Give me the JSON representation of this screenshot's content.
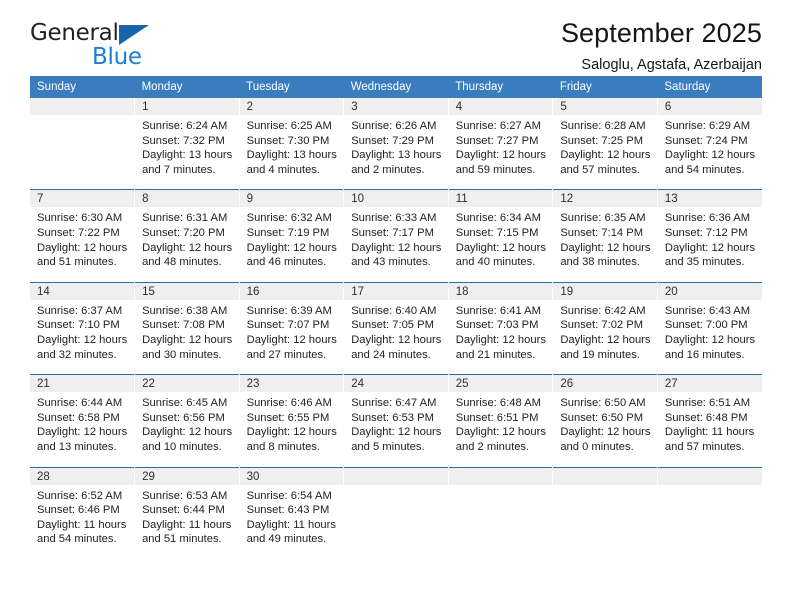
{
  "brand": {
    "line1": "General",
    "line2": "Blue",
    "triangle_color": "#1665ac",
    "line2_color": "#1b7fd4"
  },
  "header": {
    "title": "September 2025",
    "subtitle": "Saloglu, Agstafa, Azerbaijan"
  },
  "theme": {
    "header_blue": "#3a7dbf",
    "row_divider_blue": "#2b6ca8",
    "daynum_band": "#efefef"
  },
  "calendar": {
    "weekday_headers": [
      "Sunday",
      "Monday",
      "Tuesday",
      "Wednesday",
      "Thursday",
      "Friday",
      "Saturday"
    ],
    "weeks": [
      [
        {
          "day": "",
          "lines": []
        },
        {
          "day": "1",
          "lines": [
            "Sunrise: 6:24 AM",
            "Sunset: 7:32 PM",
            "Daylight: 13 hours",
            "and 7 minutes."
          ]
        },
        {
          "day": "2",
          "lines": [
            "Sunrise: 6:25 AM",
            "Sunset: 7:30 PM",
            "Daylight: 13 hours",
            "and 4 minutes."
          ]
        },
        {
          "day": "3",
          "lines": [
            "Sunrise: 6:26 AM",
            "Sunset: 7:29 PM",
            "Daylight: 13 hours",
            "and 2 minutes."
          ]
        },
        {
          "day": "4",
          "lines": [
            "Sunrise: 6:27 AM",
            "Sunset: 7:27 PM",
            "Daylight: 12 hours",
            "and 59 minutes."
          ]
        },
        {
          "day": "5",
          "lines": [
            "Sunrise: 6:28 AM",
            "Sunset: 7:25 PM",
            "Daylight: 12 hours",
            "and 57 minutes."
          ]
        },
        {
          "day": "6",
          "lines": [
            "Sunrise: 6:29 AM",
            "Sunset: 7:24 PM",
            "Daylight: 12 hours",
            "and 54 minutes."
          ]
        }
      ],
      [
        {
          "day": "7",
          "lines": [
            "Sunrise: 6:30 AM",
            "Sunset: 7:22 PM",
            "Daylight: 12 hours",
            "and 51 minutes."
          ]
        },
        {
          "day": "8",
          "lines": [
            "Sunrise: 6:31 AM",
            "Sunset: 7:20 PM",
            "Daylight: 12 hours",
            "and 48 minutes."
          ]
        },
        {
          "day": "9",
          "lines": [
            "Sunrise: 6:32 AM",
            "Sunset: 7:19 PM",
            "Daylight: 12 hours",
            "and 46 minutes."
          ]
        },
        {
          "day": "10",
          "lines": [
            "Sunrise: 6:33 AM",
            "Sunset: 7:17 PM",
            "Daylight: 12 hours",
            "and 43 minutes."
          ]
        },
        {
          "day": "11",
          "lines": [
            "Sunrise: 6:34 AM",
            "Sunset: 7:15 PM",
            "Daylight: 12 hours",
            "and 40 minutes."
          ]
        },
        {
          "day": "12",
          "lines": [
            "Sunrise: 6:35 AM",
            "Sunset: 7:14 PM",
            "Daylight: 12 hours",
            "and 38 minutes."
          ]
        },
        {
          "day": "13",
          "lines": [
            "Sunrise: 6:36 AM",
            "Sunset: 7:12 PM",
            "Daylight: 12 hours",
            "and 35 minutes."
          ]
        }
      ],
      [
        {
          "day": "14",
          "lines": [
            "Sunrise: 6:37 AM",
            "Sunset: 7:10 PM",
            "Daylight: 12 hours",
            "and 32 minutes."
          ]
        },
        {
          "day": "15",
          "lines": [
            "Sunrise: 6:38 AM",
            "Sunset: 7:08 PM",
            "Daylight: 12 hours",
            "and 30 minutes."
          ]
        },
        {
          "day": "16",
          "lines": [
            "Sunrise: 6:39 AM",
            "Sunset: 7:07 PM",
            "Daylight: 12 hours",
            "and 27 minutes."
          ]
        },
        {
          "day": "17",
          "lines": [
            "Sunrise: 6:40 AM",
            "Sunset: 7:05 PM",
            "Daylight: 12 hours",
            "and 24 minutes."
          ]
        },
        {
          "day": "18",
          "lines": [
            "Sunrise: 6:41 AM",
            "Sunset: 7:03 PM",
            "Daylight: 12 hours",
            "and 21 minutes."
          ]
        },
        {
          "day": "19",
          "lines": [
            "Sunrise: 6:42 AM",
            "Sunset: 7:02 PM",
            "Daylight: 12 hours",
            "and 19 minutes."
          ]
        },
        {
          "day": "20",
          "lines": [
            "Sunrise: 6:43 AM",
            "Sunset: 7:00 PM",
            "Daylight: 12 hours",
            "and 16 minutes."
          ]
        }
      ],
      [
        {
          "day": "21",
          "lines": [
            "Sunrise: 6:44 AM",
            "Sunset: 6:58 PM",
            "Daylight: 12 hours",
            "and 13 minutes."
          ]
        },
        {
          "day": "22",
          "lines": [
            "Sunrise: 6:45 AM",
            "Sunset: 6:56 PM",
            "Daylight: 12 hours",
            "and 10 minutes."
          ]
        },
        {
          "day": "23",
          "lines": [
            "Sunrise: 6:46 AM",
            "Sunset: 6:55 PM",
            "Daylight: 12 hours",
            "and 8 minutes."
          ]
        },
        {
          "day": "24",
          "lines": [
            "Sunrise: 6:47 AM",
            "Sunset: 6:53 PM",
            "Daylight: 12 hours",
            "and 5 minutes."
          ]
        },
        {
          "day": "25",
          "lines": [
            "Sunrise: 6:48 AM",
            "Sunset: 6:51 PM",
            "Daylight: 12 hours",
            "and 2 minutes."
          ]
        },
        {
          "day": "26",
          "lines": [
            "Sunrise: 6:50 AM",
            "Sunset: 6:50 PM",
            "Daylight: 12 hours",
            "and 0 minutes."
          ]
        },
        {
          "day": "27",
          "lines": [
            "Sunrise: 6:51 AM",
            "Sunset: 6:48 PM",
            "Daylight: 11 hours",
            "and 57 minutes."
          ]
        }
      ],
      [
        {
          "day": "28",
          "lines": [
            "Sunrise: 6:52 AM",
            "Sunset: 6:46 PM",
            "Daylight: 11 hours",
            "and 54 minutes."
          ]
        },
        {
          "day": "29",
          "lines": [
            "Sunrise: 6:53 AM",
            "Sunset: 6:44 PM",
            "Daylight: 11 hours",
            "and 51 minutes."
          ]
        },
        {
          "day": "30",
          "lines": [
            "Sunrise: 6:54 AM",
            "Sunset: 6:43 PM",
            "Daylight: 11 hours",
            "and 49 minutes."
          ]
        },
        {
          "day": "",
          "lines": []
        },
        {
          "day": "",
          "lines": []
        },
        {
          "day": "",
          "lines": []
        },
        {
          "day": "",
          "lines": []
        }
      ]
    ]
  }
}
